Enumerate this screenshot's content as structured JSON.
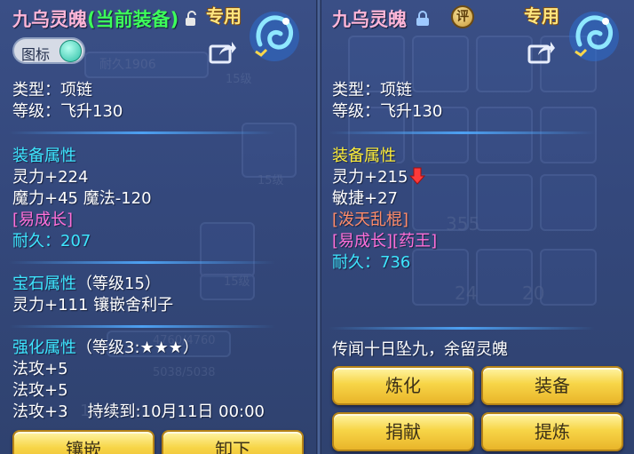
{
  "left": {
    "title": "九乌灵魄",
    "title_status": "(当前装备)",
    "exclusive": "专用",
    "toggle_label": "图标",
    "type_line": "类型：项链",
    "level_line": "等级：飞升130",
    "attr_header": "装备属性",
    "attr1": "灵力+224",
    "attr2": "魔力+45 魔法-120",
    "special": "[易成长]",
    "durability": "耐久：207",
    "gem_header": "宝石属性",
    "gem_level": "（等级15）",
    "gem_line": "灵力+111 镶嵌舍利子",
    "enhance_header": "强化属性",
    "enhance_level": "（等级3:★★★）",
    "enh1": "法攻+5",
    "enh2": "法攻+5",
    "enh3": "法攻+3",
    "enh3_duration": "持续到:10月11日 00:00",
    "buttons": [
      "镶嵌",
      "卸下"
    ]
  },
  "right": {
    "title": "九乌灵魄",
    "rate_icon_label": "评",
    "exclusive": "专用",
    "type_line": "类型：项链",
    "level_line": "等级：飞升130",
    "attr_header": "装备属性",
    "attr1": "灵力+215",
    "attr2": "敏捷+27",
    "special1": "[泼天乱棍]",
    "special2": "[易成长][药王]",
    "durability": "耐久：736",
    "lore": "传闻十日坠九，余留灵魄",
    "buttons": [
      "炼化",
      "装备",
      "捐献",
      "提炼"
    ]
  },
  "background": {
    "left_numbers": [
      "耐久1906",
      "15级",
      "15级",
      "15级",
      "4760/4760",
      "5038/5038",
      "13"
    ],
    "right_numbers": [
      "355",
      "24",
      "20"
    ]
  },
  "colors": {
    "panel": "#34487c",
    "button": "#f7d547",
    "attr_yellow": "#ffef3a",
    "durability_cyan": "#3ee6ff",
    "special_pink": "#ff6fd8",
    "special_orange": "#ff8c6a",
    "title_pink": "#ffb6d8",
    "status_green": "#3dff5a"
  },
  "icons": [
    "lock-open-icon",
    "lock-closed-icon",
    "rate-icon",
    "share-icon",
    "pendant-icon",
    "down-arrow-icon"
  ]
}
